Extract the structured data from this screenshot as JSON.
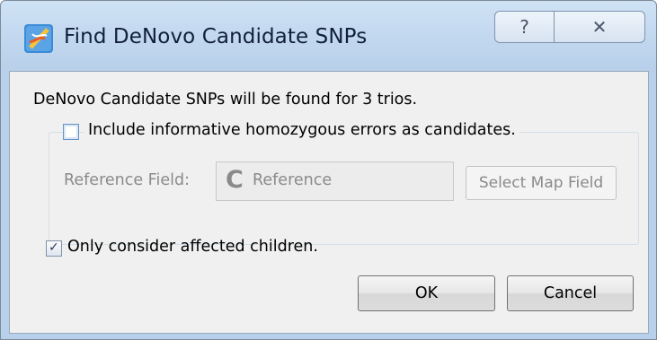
{
  "window": {
    "title": "Find DeNovo Candidate SNPs",
    "icon": "dna-helix-icon",
    "help_glyph": "?",
    "close_glyph": "✕"
  },
  "dialog": {
    "info_text": "DeNovo Candidate SNPs will be found for 3 trios.",
    "include_checkbox": {
      "label": "Include informative homozygous errors as candidates.",
      "checked": false
    },
    "reference_field": {
      "label": "Reference Field:",
      "icon_glyph": "C",
      "value": "Reference",
      "enabled": false
    },
    "select_map_field_label": "Select Map Field",
    "affected_checkbox": {
      "label": "Only consider affected children.",
      "checked": true,
      "mark": "✓"
    }
  },
  "buttons": {
    "ok": "OK",
    "cancel": "Cancel"
  },
  "colors": {
    "title_bar": "#c2d8ef",
    "client_bg": "#f0f0f0",
    "disabled_text": "#8a8a8a"
  }
}
